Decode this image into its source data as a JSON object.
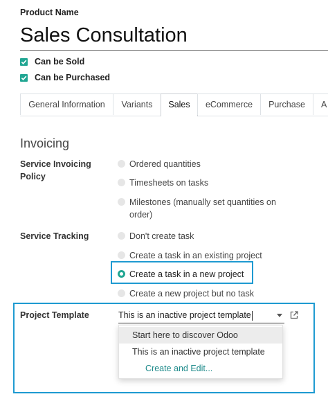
{
  "product": {
    "label": "Product Name",
    "name": "Sales Consultation"
  },
  "flags": {
    "can_be_sold": "Can be Sold",
    "can_be_purchased": "Can be Purchased"
  },
  "tabs": [
    {
      "label": "General Information"
    },
    {
      "label": "Variants"
    },
    {
      "label": "Sales"
    },
    {
      "label": "eCommerce"
    },
    {
      "label": "Purchase"
    },
    {
      "label": "A"
    }
  ],
  "active_tab": "Sales",
  "invoicing": {
    "title": "Invoicing",
    "service_invoicing_policy": {
      "label": "Service Invoicing Policy",
      "options": [
        {
          "label": "Ordered quantities"
        },
        {
          "label": "Timesheets on tasks"
        },
        {
          "label": "Milestones (manually set quantities on order)"
        }
      ]
    },
    "service_tracking": {
      "label": "Service Tracking",
      "options": [
        {
          "label": "Don't create task"
        },
        {
          "label": "Create a task in an existing project"
        },
        {
          "label": "Create a task in a new project"
        },
        {
          "label": "Create a new project but no task"
        }
      ],
      "selected": "Create a task in a new project"
    },
    "project_template": {
      "label": "Project Template",
      "value": "This is an inactive project template",
      "dropdown": [
        {
          "label": "Start here to discover Odoo"
        },
        {
          "label": "This is an inactive project template"
        },
        {
          "label": "Create and Edit..."
        }
      ]
    }
  },
  "colors": {
    "accent": "#21a693",
    "highlight": "#1e9ad1",
    "link": "#1d8a8a"
  }
}
